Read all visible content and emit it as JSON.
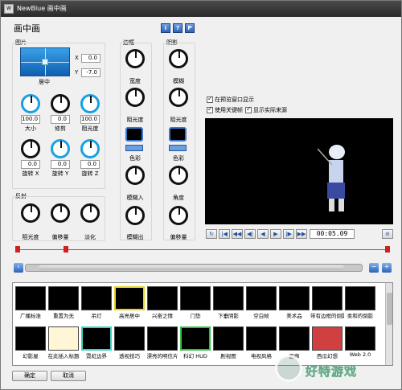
{
  "window": {
    "title": "NewBlue 画中画",
    "app_icon": "W"
  },
  "heading": "画中画",
  "top_buttons": [
    "i",
    "?",
    "P"
  ],
  "picture": {
    "group": "图片",
    "x_label": "X",
    "x_value": "0.0",
    "y_label": "Y",
    "y_value": "-7.0",
    "center_label": "居中",
    "knobs": [
      {
        "value": "100.0",
        "label": "大小"
      },
      {
        "value": "0.0",
        "label": "修剪"
      },
      {
        "value": "100.0",
        "label": "阻光度"
      },
      {
        "value": "0.0",
        "label": "旋转 X"
      },
      {
        "value": "0.0",
        "label": "旋转 Y"
      },
      {
        "value": "0.0",
        "label": "旋转 Z"
      }
    ]
  },
  "reflection": {
    "group": "反射",
    "knobs": [
      {
        "label": "阻光度"
      },
      {
        "label": "偏移量"
      },
      {
        "label": "淡化"
      }
    ]
  },
  "border": {
    "group": "边框",
    "items": [
      "宽度",
      "阻光度",
      "色彩",
      "模糊入",
      "模糊出"
    ]
  },
  "shadow": {
    "group": "阴影",
    "items": [
      "模糊",
      "阻光度",
      "色彩",
      "角度",
      "偏移量"
    ]
  },
  "options": {
    "show_in_preview": "在预览窗口显示",
    "use_keyframes": "使用关键帧",
    "show_actual_source": "显示实际来源"
  },
  "transport": {
    "buttons": [
      "↻",
      "|◀",
      "◀◀",
      "◀|",
      "◀",
      "▶",
      "|▶",
      "▶▶",
      "▶|"
    ],
    "timecode": "00:05.09",
    "settings_icon": "⊘"
  },
  "presets": [
    "广播标准",
    "重置为无",
    "吊灯",
    "高亮居中",
    "兴奋之情",
    "门垫",
    "下垂阴影",
    "空白帧",
    "美术品",
    "带有边框的倒影",
    "柔和的倒影",
    "幻影屋",
    "在此插入标题",
    "霓虹边界",
    "透视技巧",
    "漂亮的明信片",
    "科幻 HUD",
    "剧视图",
    "电视风格",
    "画廊",
    "西瓜幻想",
    "Web 2.0"
  ],
  "footer": {
    "ok": "确定",
    "cancel": "取消"
  },
  "watermark": "好特游戏",
  "colors": {
    "accent": "#2f63b8",
    "titlebar": "#2b2b2b",
    "marker": "#d02020"
  }
}
